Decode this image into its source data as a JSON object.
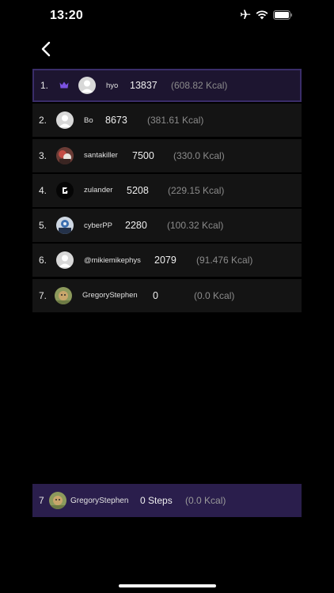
{
  "status": {
    "time": "13:20",
    "icons": [
      "airplane-icon",
      "wifi-icon",
      "battery-icon"
    ]
  },
  "nav": {
    "back_icon": "chevron-left-icon"
  },
  "colors": {
    "background": "#000000",
    "row": "#141414",
    "highlight": "#1d1530",
    "highlight_border": "#3a2d69",
    "my_rank": "#2a1e4c",
    "crown": "#7b52e0"
  },
  "leaderboard": [
    {
      "rank": "1.",
      "name": "hyo",
      "steps": "13837",
      "kcal": "(608.82 Kcal)",
      "avatar": "default",
      "crown": true
    },
    {
      "rank": "2.",
      "name": "Bo",
      "steps": "8673",
      "kcal": "(381.61 Kcal)",
      "avatar": "default"
    },
    {
      "rank": "3.",
      "name": "santakiller",
      "steps": "7500",
      "kcal": "(330.0 Kcal)",
      "avatar": "photo-red"
    },
    {
      "rank": "4.",
      "name": "zulander",
      "steps": "5208",
      "kcal": "(229.15 Kcal)",
      "avatar": "logo-black"
    },
    {
      "rank": "5.",
      "name": "cyberPP",
      "steps": "2280",
      "kcal": "(100.32 Kcal)",
      "avatar": "photo-blue"
    },
    {
      "rank": "6.",
      "name": "@mikiemikephys",
      "steps": "2079",
      "kcal": "(91.476 Kcal)",
      "avatar": "default"
    },
    {
      "rank": "7.",
      "name": "GregoryStephen",
      "steps": "0",
      "kcal": "(0.0 Kcal)",
      "avatar": "photo-cat"
    }
  ],
  "my_rank": {
    "rank": "7",
    "name": "GregoryStephen",
    "steps": "0 Steps",
    "kcal": "(0.0 Kcal)",
    "avatar": "photo-cat"
  }
}
